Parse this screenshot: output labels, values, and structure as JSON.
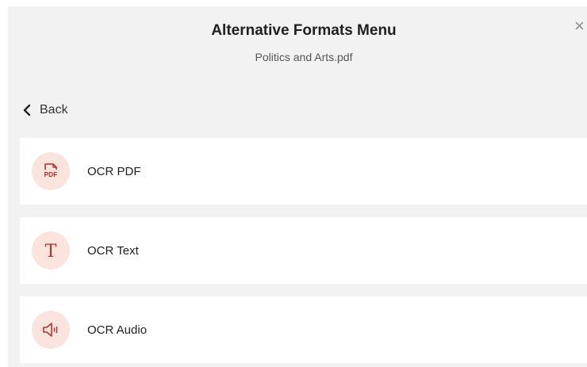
{
  "header": {
    "title": "Alternative Formats Menu",
    "filename": "Politics and Arts.pdf",
    "close_glyph": "×"
  },
  "nav": {
    "back_label": "Back"
  },
  "items": [
    {
      "label": "OCR PDF",
      "icon": "pdf-file-icon",
      "icon_text": "PDF"
    },
    {
      "label": "OCR Text",
      "icon": "text-t-icon",
      "icon_text": "T"
    },
    {
      "label": "OCR Audio",
      "icon": "speaker-icon"
    }
  ],
  "colors": {
    "accent": "#b0352c",
    "icon_background": "#fbe3de",
    "panel_background": "#f2f2f2"
  }
}
